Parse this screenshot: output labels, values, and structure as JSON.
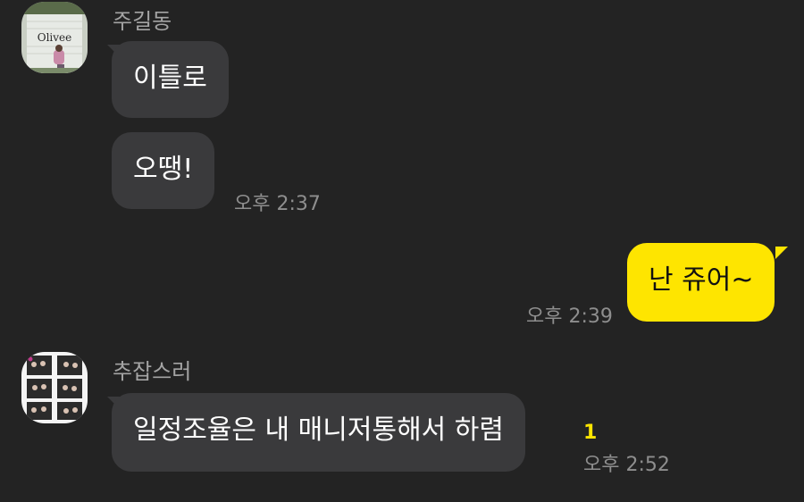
{
  "messages": [
    {
      "sender": "주길동",
      "avatar_icon": "storefront-photo",
      "avatar_text": "Olivee",
      "bubbles": [
        "이틀로",
        "오땡!"
      ],
      "time": "오후 2:37"
    },
    {
      "sender": "me",
      "bubbles": [
        "난 쥬어~"
      ],
      "time": "오후 2:39"
    },
    {
      "sender": "추잡스러",
      "avatar_icon": "photo-booth-strip",
      "bubbles": [
        "일정조율은 내 매니저통해서 하렴"
      ],
      "unread_count": "1",
      "time": "오후 2:52"
    }
  ],
  "colors": {
    "background": "#232323",
    "incoming_bubble": "#3a3a3c",
    "outgoing_bubble": "#fee500",
    "unread": "#fee500"
  }
}
